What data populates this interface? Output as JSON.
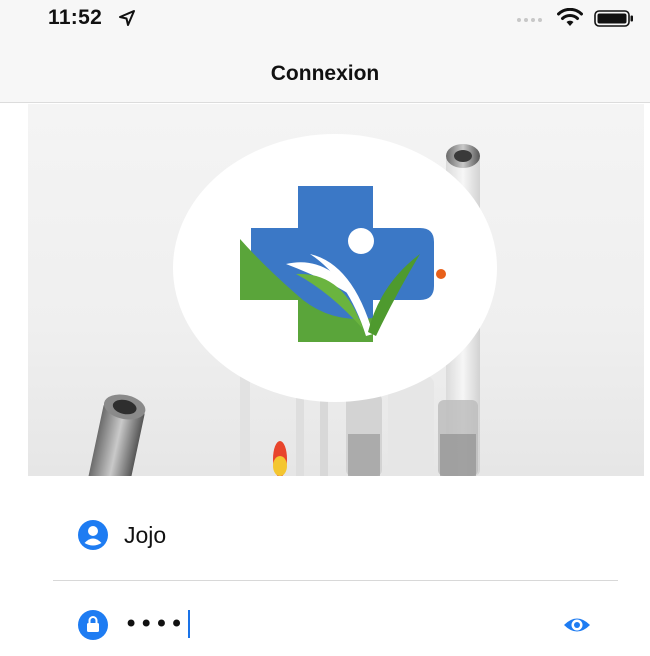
{
  "status_bar": {
    "time": "11:52",
    "icons": [
      "location-arrow-icon",
      "signal-dots-icon",
      "wifi-icon",
      "battery-icon"
    ]
  },
  "nav": {
    "title": "Connexion"
  },
  "hero": {
    "description_icon": "pharmacy-cross-logo",
    "colors": {
      "blue": "#3a78c7",
      "green": "#5aa53a",
      "orange": "#e8601a"
    }
  },
  "form": {
    "username": {
      "icon": "user-icon",
      "value": "Jojo"
    },
    "password": {
      "icon": "lock-icon",
      "value": "••••",
      "toggle_icon": "eye-icon"
    }
  },
  "theme": {
    "accent": "#1e7cf2",
    "nav_bg": "#f7f7f7"
  }
}
